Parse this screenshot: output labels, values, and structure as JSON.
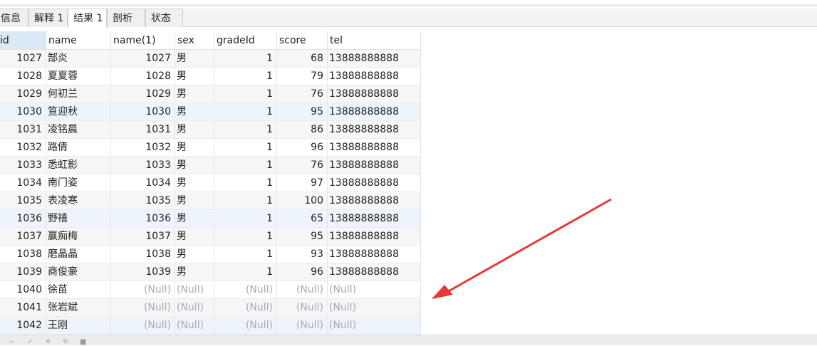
{
  "tabs": [
    {
      "label": "信息"
    },
    {
      "label": "解释 1"
    },
    {
      "label": "结果 1",
      "active": true
    },
    {
      "label": "剖析"
    },
    {
      "label": "状态"
    }
  ],
  "columns": [
    "id",
    "name",
    "name(1)",
    "sex",
    "gradeId",
    "score",
    "tel"
  ],
  "rows": [
    [
      "1027",
      "郜炎",
      "1027",
      "男",
      "1",
      "68",
      "13888888888"
    ],
    [
      "1028",
      "夏夏蓉",
      "1028",
      "男",
      "1",
      "79",
      "13888888888"
    ],
    [
      "1029",
      "何初兰",
      "1029",
      "男",
      "1",
      "76",
      "13888888888"
    ],
    [
      "1030",
      "笪迎秋",
      "1030",
      "男",
      "1",
      "95",
      "13888888888"
    ],
    [
      "1031",
      "凌铭晨",
      "1031",
      "男",
      "1",
      "86",
      "13888888888"
    ],
    [
      "1032",
      "路倩",
      "1032",
      "男",
      "1",
      "96",
      "13888888888"
    ],
    [
      "1033",
      "悉虹影",
      "1033",
      "男",
      "1",
      "76",
      "13888888888"
    ],
    [
      "1034",
      "南门姿",
      "1034",
      "男",
      "1",
      "97",
      "13888888888"
    ],
    [
      "1035",
      "表凌寒",
      "1035",
      "男",
      "1",
      "100",
      "13888888888"
    ],
    [
      "1036",
      "野禧",
      "1036",
      "男",
      "1",
      "65",
      "13888888888"
    ],
    [
      "1037",
      "赢痴梅",
      "1037",
      "男",
      "1",
      "95",
      "13888888888"
    ],
    [
      "1038",
      "磨晶晶",
      "1038",
      "男",
      "1",
      "93",
      "13888888888"
    ],
    [
      "1039",
      "商俊豪",
      "1039",
      "男",
      "1",
      "96",
      "13888888888"
    ],
    [
      "1040",
      "徐苗",
      "(Null)",
      "(Null)",
      "(Null)",
      "(Null)",
      "(Null)"
    ],
    [
      "1041",
      "张岩斌",
      "(Null)",
      "(Null)",
      "(Null)",
      "(Null)",
      "(Null)"
    ],
    [
      "1042",
      "王刚",
      "(Null)",
      "(Null)",
      "(Null)",
      "(Null)",
      "(Null)"
    ]
  ],
  "annotation": {
    "color": "#e53935",
    "icon": "red-arrow-icon"
  },
  "bottom_toolbar_icons": [
    "minus-icon",
    "check-icon",
    "cross-icon",
    "refresh-icon",
    "stop-icon"
  ]
}
